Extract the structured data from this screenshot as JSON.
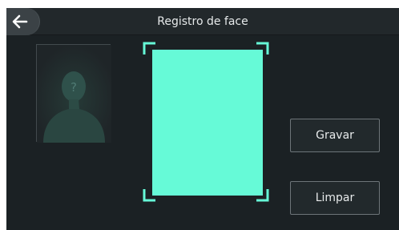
{
  "header": {
    "title": "Registro de face",
    "back_icon": "arrow-left-icon"
  },
  "photo_placeholder": {
    "icon": "unknown-user-icon",
    "mark": "?"
  },
  "capture": {
    "fill_color": "#66fad7",
    "corner_color": "#66fad7"
  },
  "actions": {
    "save_label": "Gravar",
    "clear_label": "Limpar"
  },
  "colors": {
    "background": "#1b2124",
    "titlebar": "#22282b",
    "accent": "#66fad7"
  }
}
